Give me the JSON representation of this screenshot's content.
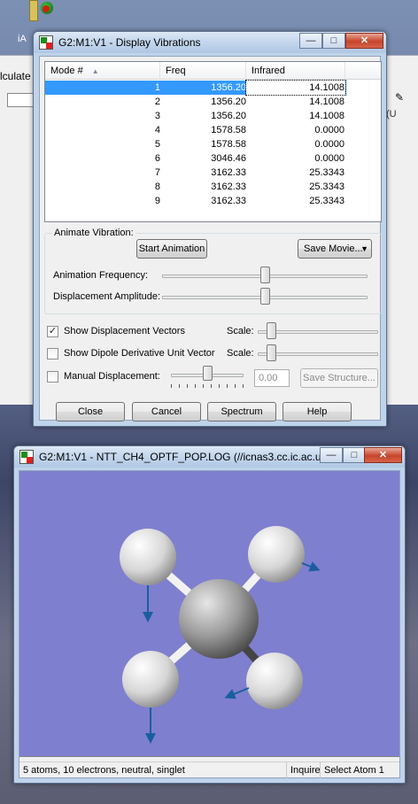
{
  "desktop": {
    "icon_label": "iA"
  },
  "background_app": {
    "menu_fragment": "lculate",
    "right_menu": "(U"
  },
  "dialog": {
    "title": "G2:M1:V1 - Display Vibrations",
    "title_buttons": {
      "minimize": "—",
      "maximize": "□",
      "close": "✕"
    },
    "columns": [
      "Mode #",
      "Freq",
      "Infrared"
    ],
    "rows": [
      {
        "mode": "1",
        "freq": "1356.20",
        "ir": "14.1008",
        "selected": true
      },
      {
        "mode": "2",
        "freq": "1356.20",
        "ir": "14.1008"
      },
      {
        "mode": "3",
        "freq": "1356.20",
        "ir": "14.1008"
      },
      {
        "mode": "4",
        "freq": "1578.58",
        "ir": "0.0000"
      },
      {
        "mode": "5",
        "freq": "1578.58",
        "ir": "0.0000"
      },
      {
        "mode": "6",
        "freq": "3046.46",
        "ir": "0.0000"
      },
      {
        "mode": "7",
        "freq": "3162.33",
        "ir": "25.3343"
      },
      {
        "mode": "8",
        "freq": "3162.33",
        "ir": "25.3343"
      },
      {
        "mode": "9",
        "freq": "3162.33",
        "ir": "25.3343"
      }
    ],
    "animate_group_label": "Animate Vibration:",
    "start_animation": "Start Animation",
    "save_movie": "Save Movie...",
    "animation_frequency_label": "Animation Frequency:",
    "displacement_amplitude_label": "Displacement Amplitude:",
    "show_displacement_vectors": "Show Displacement Vectors",
    "show_dipole": "Show Dipole Derivative Unit Vector",
    "manual_displacement": "Manual Displacement:",
    "scale_label": "Scale:",
    "manual_value": "0.00",
    "save_structure": "Save Structure...",
    "close": "Close",
    "cancel": "Cancel",
    "spectrum": "Spectrum",
    "help": "Help",
    "checkbox_mark": "✓",
    "animation_frequency_level": 0.5,
    "displacement_amplitude_level": 0.5
  },
  "viewer": {
    "title": "G2:M1:V1 - NTT_CH4_OPTF_POP.LOG (//icnas3.cc.ic.ac.u...",
    "title_buttons": {
      "minimize": "—",
      "maximize": "□",
      "close": "✕"
    },
    "status": "5 atoms, 10 electrons, neutral, singlet",
    "status_inquire": "Inquire",
    "status_select": "Select Atom 1",
    "colors": {
      "background": "#7f7fcf",
      "arrow": "#1a5ea0"
    }
  }
}
